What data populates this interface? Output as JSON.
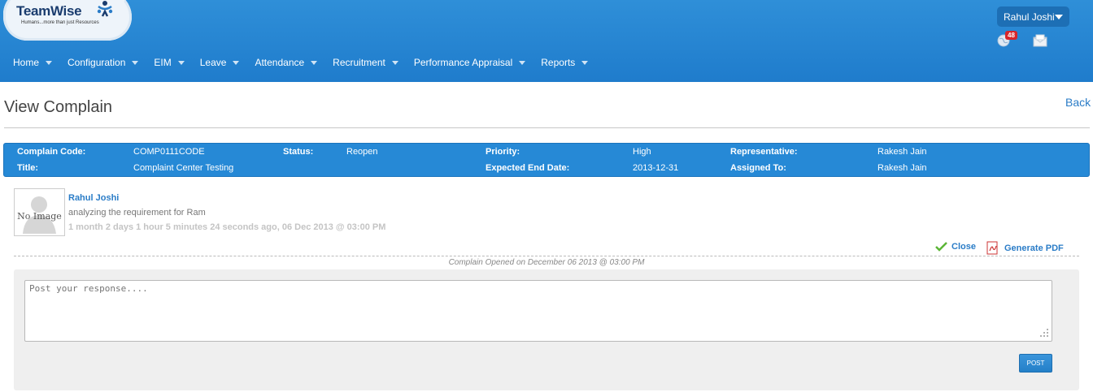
{
  "brand": {
    "name": "TeamWise",
    "tagline": "Humans...more than just Resources"
  },
  "nav": [
    {
      "label": "Home"
    },
    {
      "label": "Configuration"
    },
    {
      "label": "EIM"
    },
    {
      "label": "Leave"
    },
    {
      "label": "Attendance"
    },
    {
      "label": "Recruitment"
    },
    {
      "label": "Performance Appraisal"
    },
    {
      "label": "Reports"
    }
  ],
  "user": {
    "name": "Rahul Joshi",
    "notification_count": "48"
  },
  "page": {
    "title": "View Complain",
    "back_label": "Back"
  },
  "info": {
    "complain_code_label": "Complain Code:",
    "complain_code": "COMP0111CODE",
    "title_label": "Title:",
    "title": "Complaint Center Testing",
    "status_label": "Status:",
    "status": "Reopen",
    "priority_label": "Priority:",
    "priority": "High",
    "end_date_label": "Expected End Date:",
    "end_date": "2013-12-31",
    "representative_label": "Representative:",
    "representative": "Rakesh Jain",
    "assigned_label": "Assigned To:",
    "assigned": "Rakesh Jain"
  },
  "comment": {
    "avatar_text": "No Image",
    "author": "Rahul Joshi",
    "text": "analyzing the requirement for Ram",
    "time": "1 month 2 days 1 hour 5 minutes 24 seconds ago, 06 Dec 2013 @ 03:00 PM"
  },
  "actions": {
    "close_label": "Close",
    "pdf_label": "Generate PDF"
  },
  "opened_text": "Complain Opened on December 06 2013 @ 03:00 PM",
  "response": {
    "placeholder": "Post your response....",
    "post_label": "POST"
  },
  "colors": {
    "header": "#2689d6",
    "link": "#2a7cc7",
    "badge": "#d8262a"
  }
}
